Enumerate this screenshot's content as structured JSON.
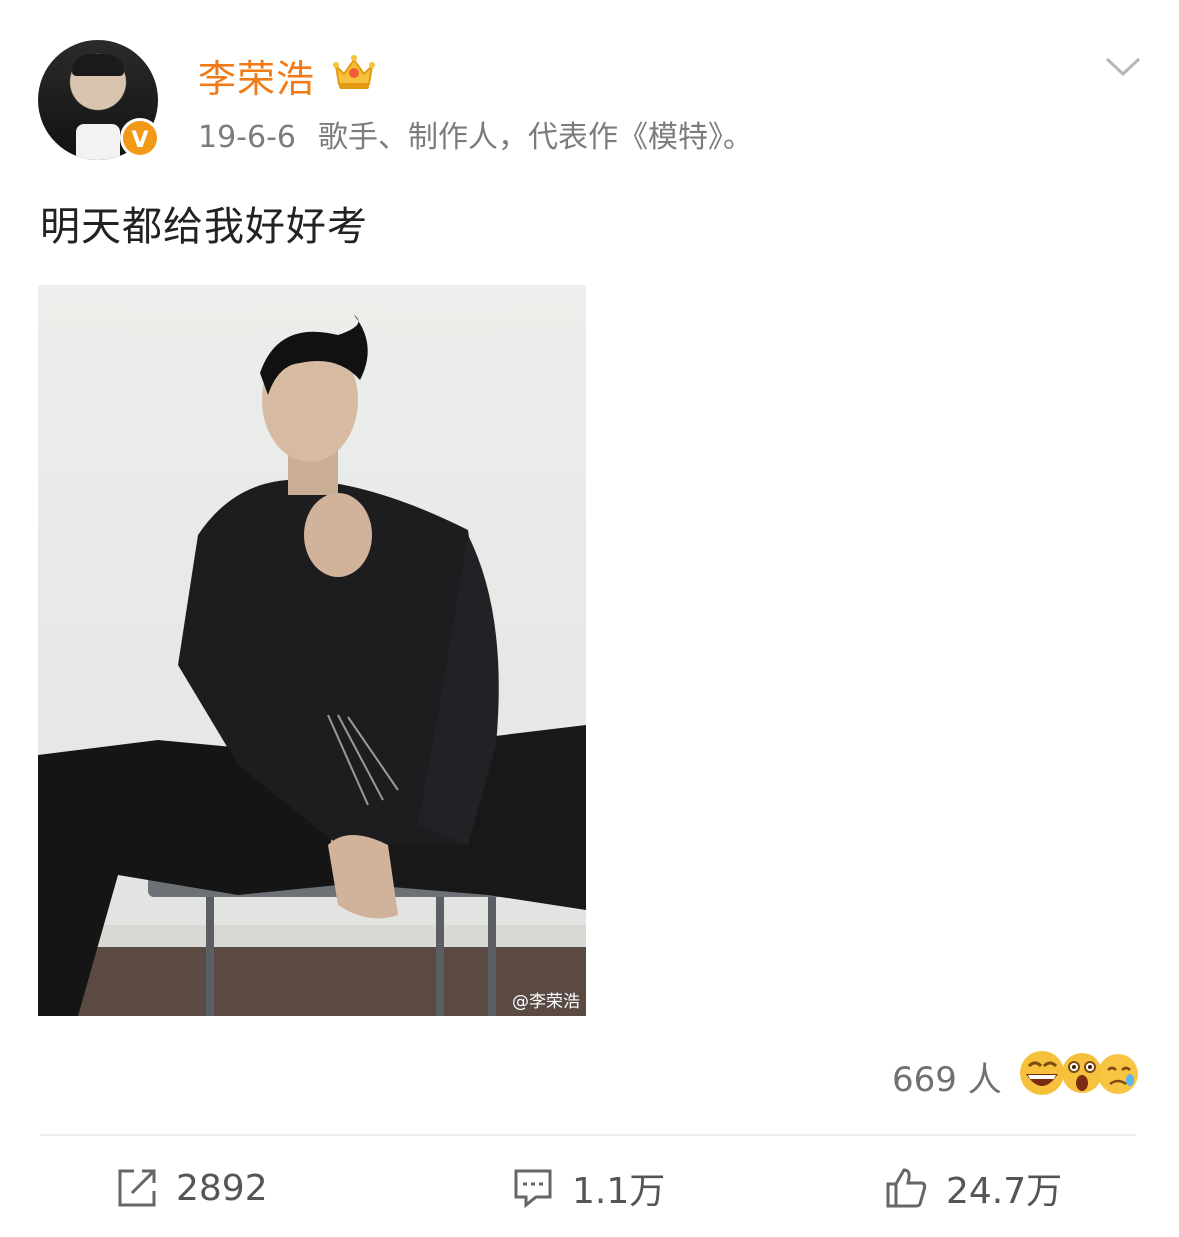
{
  "author": {
    "name": "李荣浩",
    "verified_badge": "V",
    "avatar_icon": "avatar",
    "crown_icon": "crown-icon"
  },
  "meta": {
    "date": "19-6-6",
    "description": "歌手、制作人，代表作《模特》。"
  },
  "post": {
    "text": "明天都给我好好考",
    "image_watermark": "@李荣浩"
  },
  "reactions": {
    "count_label": "669 人",
    "emojis": [
      "laughing-emoji",
      "shocked-emoji",
      "crying-emoji"
    ]
  },
  "actions": {
    "share": {
      "icon": "share-icon",
      "label": "2892"
    },
    "comment": {
      "icon": "comment-icon",
      "label": "1.1万"
    },
    "like": {
      "icon": "thumbs-up-icon",
      "label": "24.7万"
    }
  },
  "colors": {
    "username": "#f07a16",
    "badge": "#f29a17",
    "muted_text": "#7c7c7c"
  }
}
